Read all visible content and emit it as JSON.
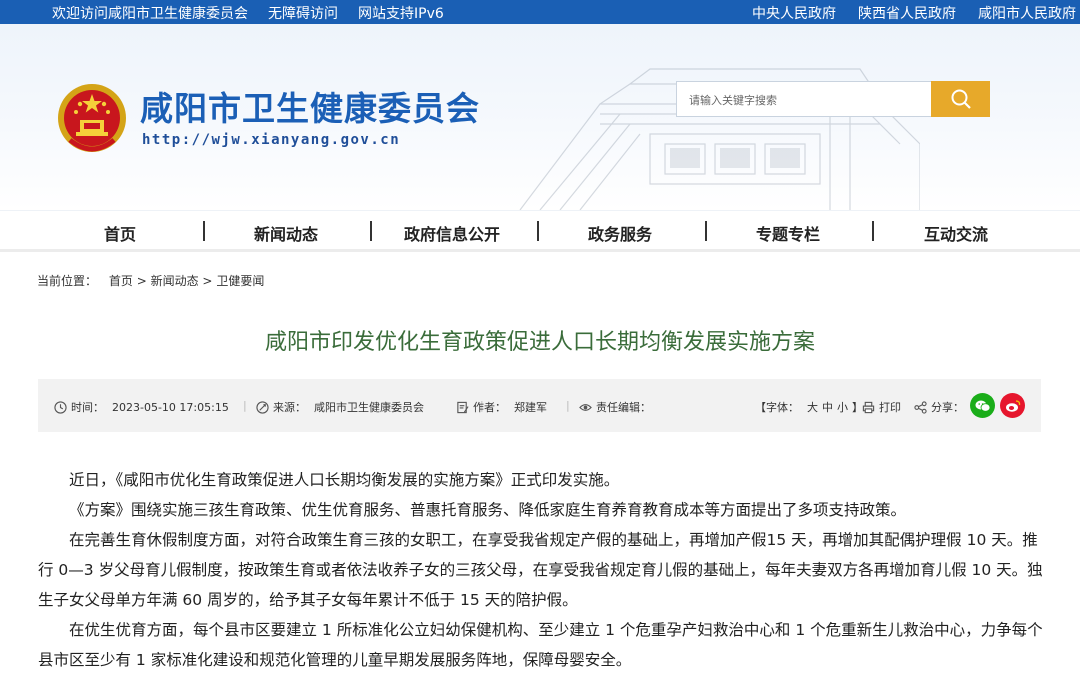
{
  "topbar": {
    "welcome": "欢迎访问咸阳市卫生健康委员会",
    "accessible": "无障碍访问",
    "ipv6": "网站支持IPv6",
    "gov_links": [
      "中央人民政府",
      "陕西省人民政府",
      "咸阳市人民政府"
    ]
  },
  "header": {
    "site_title": "咸阳市卫生健康委员会",
    "site_url": "http://wjw.xianyang.gov.cn",
    "search_placeholder": "请输入关键字搜索"
  },
  "nav": [
    "首页",
    "新闻动态",
    "政府信息公开",
    "政务服务",
    "专题专栏",
    "互动交流"
  ],
  "breadcrumb": {
    "label": "当前位置：",
    "items": [
      "首页",
      "新闻动态",
      "卫健要闻"
    ],
    "sep": ">"
  },
  "article": {
    "title": "咸阳市印发优化生育政策促进人口长期均衡发展实施方案",
    "meta": {
      "time_label": "时间：",
      "time": "2023-05-10 17:05:15",
      "source_label": "来源：",
      "source": "咸阳市卫生健康委员会",
      "author_label": "作者：",
      "author": "郑建军",
      "editor_label": "责任编辑：",
      "font_label": "【字体：",
      "font_large": "大",
      "font_medium": "中",
      "font_small": "小",
      "font_end": "】",
      "print": "打印",
      "share": "分享："
    },
    "paragraphs": [
      "近日，《咸阳市优化生育政策促进人口长期均衡发展的实施方案》正式印发实施。",
      "《方案》围绕实施三孩生育政策、优生优育服务、普惠托育服务、降低家庭生育养育教育成本等方面提出了多项支持政策。",
      "在完善生育休假制度方面，对符合政策生育三孩的女职工，在享受我省规定产假的基础上，再增加产假15 天，再增加其配偶护理假 10 天。推行 0—3 岁父母育儿假制度，按政策生育或者依法收养子女的三孩父母，在享受我省规定育儿假的基础上，每年夫妻双方各再增加育儿假 10 天。独生子女父母单方年满 60 周岁的，给予其子女每年累计不低于 15 天的陪护假。",
      "在优生优育方面，每个县市区要建立 1 所标准化公立妇幼保健机构、至少建立 1 个危重孕产妇救治中心和 1 个危重新生儿救治中心，力争每个县市区至少有 1 家标准化建设和规范化管理的儿童早期发展服务阵地，保障母婴安全。"
    ]
  },
  "colors": {
    "topbar": "#1a5fb4",
    "title_blue": "#1b5fb6",
    "search_button": "#e7a92a",
    "article_title": "#3a6c3a",
    "wechat": "#1aad19",
    "weibo": "#e6162d"
  },
  "icons": [
    "national-emblem",
    "search-icon",
    "clock-icon",
    "source-icon",
    "author-icon",
    "editor-icon",
    "print-icon",
    "share-icon",
    "wechat-icon",
    "weibo-icon"
  ]
}
